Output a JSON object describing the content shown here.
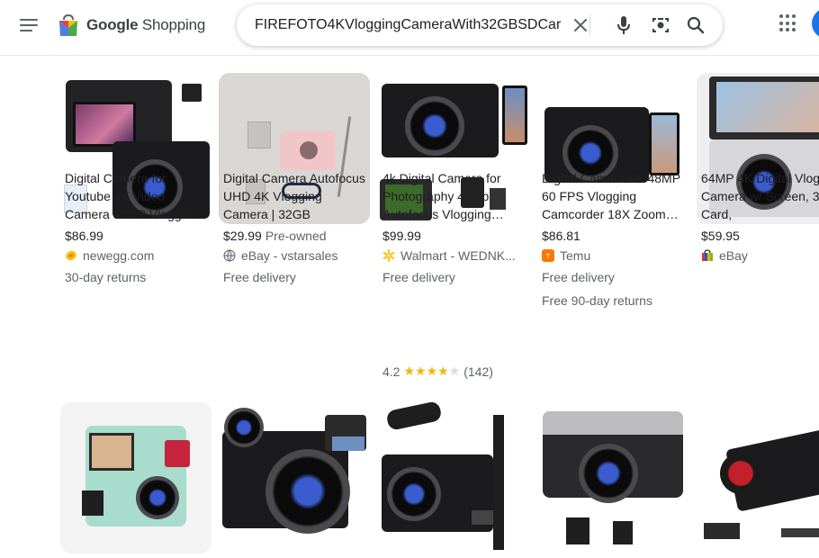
{
  "header": {
    "logo_bold": "Google",
    "logo_text": "Shopping",
    "search_value": "FIREFOTO4KVloggingCameraWith32GBSDCar",
    "colors": {
      "accent": "#1a73e8",
      "brand_red": "#ea4335",
      "brand_yellow": "#fbbc04",
      "brand_green": "#34a853"
    }
  },
  "products_row1": [
    {
      "title": "Digital Camera for Youtube 4K Video Camera 56MP Vlogging Camera",
      "price": "$86.99",
      "seller": "newegg.com",
      "line1": "30-day returns"
    },
    {
      "title": "Digital Camera Autofocus UHD 4K Vlogging Camera | 32GB",
      "price": "$29.99",
      "price_sub": "Pre-owned",
      "seller": "eBay - vstarsales",
      "line1": "Free delivery"
    },
    {
      "title": "4k Digital Camera for Photography 48mp Autofocus Vlogging Camera",
      "price": "$99.99",
      "seller": "Walmart - WEDNK...",
      "line1": "Free delivery",
      "rating": "4.2",
      "reviews": "(142)",
      "stars_filled": 4
    },
    {
      "title": "Digital Camera 4K 48MP 60 FPS Vlogging Camcorder 18X Zoom Camera",
      "price": "$86.81",
      "seller": "Temu",
      "line1": "Free delivery",
      "line2": "Free 90-day returns"
    },
    {
      "title": "64MP 4K Digital Vlogging Camera w/ Screen, 32GB Card,",
      "price": "$59.95",
      "seller": "eBay"
    }
  ]
}
